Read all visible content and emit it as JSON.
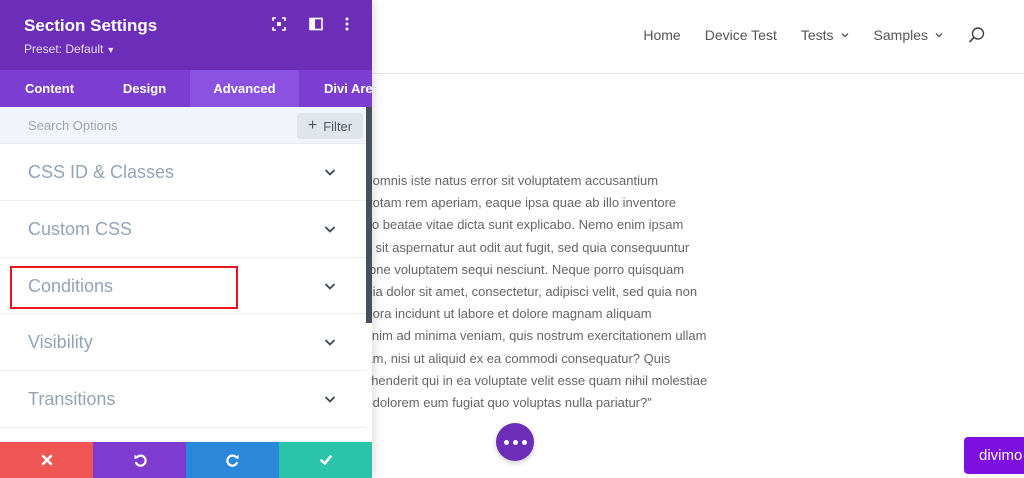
{
  "nav": {
    "items": [
      {
        "label": "Home",
        "dropdown": false
      },
      {
        "label": "Device Test",
        "dropdown": false
      },
      {
        "label": "Tests",
        "dropdown": true
      },
      {
        "label": "Samples",
        "dropdown": true
      }
    ],
    "search_icon": "search-icon"
  },
  "content": {
    "lines": [
      "s unde omnis iste natus error sit voluptatem accusantium",
      "ntium, totam rem aperiam, eaque ipsa quae ab illo inventore",
      "rchitecto beatae vitae dicta sunt explicabo. Nemo enim ipsam",
      "oluptas sit aspernatur aut odit aut fugit, sed quia consequuntur",
      "qui ratione voluptatem sequi nesciunt. Neque porro quisquam",
      "sum quia dolor sit amet, consectetur, adipisci velit, sed quia non",
      "di tempora incidunt ut labore et dolore magnam aliquam",
      "m. Ut enim ad minima veniam, quis nostrum exercitationem ullam",
      "boriosam, nisi ut aliquid ex ea commodi consequatur? Quis",
      "e reprehenderit qui in ea voluptate velit esse quam nihil molestiae",
      "um qui dolorem eum fugiat quo voluptas nulla pariatur?\""
    ]
  },
  "badge": {
    "label": "divimo"
  },
  "modal": {
    "title": "Section Settings",
    "preset": "Preset: Default",
    "tabs": [
      {
        "label": "Content",
        "active": false
      },
      {
        "label": "Design",
        "active": false
      },
      {
        "label": "Advanced",
        "active": true
      },
      {
        "label": "Divi Are",
        "active": false
      }
    ],
    "search": {
      "placeholder": "Search Options",
      "value": ""
    },
    "filter_label": "Filter",
    "groups": [
      {
        "label": "CSS ID & Classes"
      },
      {
        "label": "Custom CSS"
      },
      {
        "label": "Conditions"
      },
      {
        "label": "Visibility"
      },
      {
        "label": "Transitions"
      }
    ],
    "footer": [
      {
        "name": "cancel",
        "icon": "close-icon",
        "color": "#ef5555"
      },
      {
        "name": "undo",
        "icon": "undo-icon",
        "color": "#7e3bd0"
      },
      {
        "name": "redo",
        "icon": "redo-icon",
        "color": "#2b87da"
      },
      {
        "name": "save",
        "icon": "check-icon",
        "color": "#29c4a9"
      }
    ]
  },
  "colors": {
    "header_purple": "#6c2eb9",
    "tab_purple": "#7b3ed1",
    "tab_active": "#8b51e0",
    "highlight_red": "#e8151b"
  }
}
